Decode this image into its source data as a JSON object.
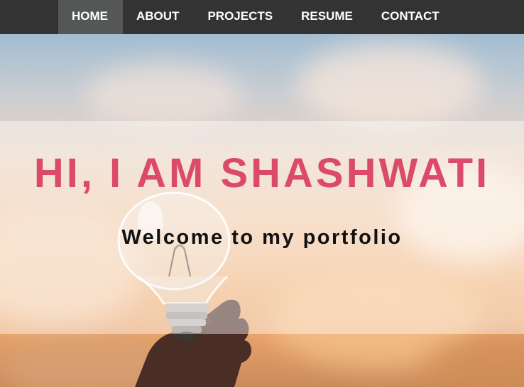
{
  "nav": {
    "items": [
      {
        "label": "HOME",
        "active": true
      },
      {
        "label": "ABOUT",
        "active": false
      },
      {
        "label": "PROJECTS",
        "active": false
      },
      {
        "label": "RESUME",
        "active": false
      },
      {
        "label": "CONTACT",
        "active": false
      }
    ]
  },
  "hero": {
    "title": "HI, I AM SHASHWATI",
    "subtitle": "Welcome to my portfolio",
    "title_color": "#db4a6a",
    "background_image": "lightbulb-in-hand-icon"
  },
  "colors": {
    "navbar": "#333333",
    "nav_active": "#555757",
    "nav_text": "#ffffff"
  }
}
